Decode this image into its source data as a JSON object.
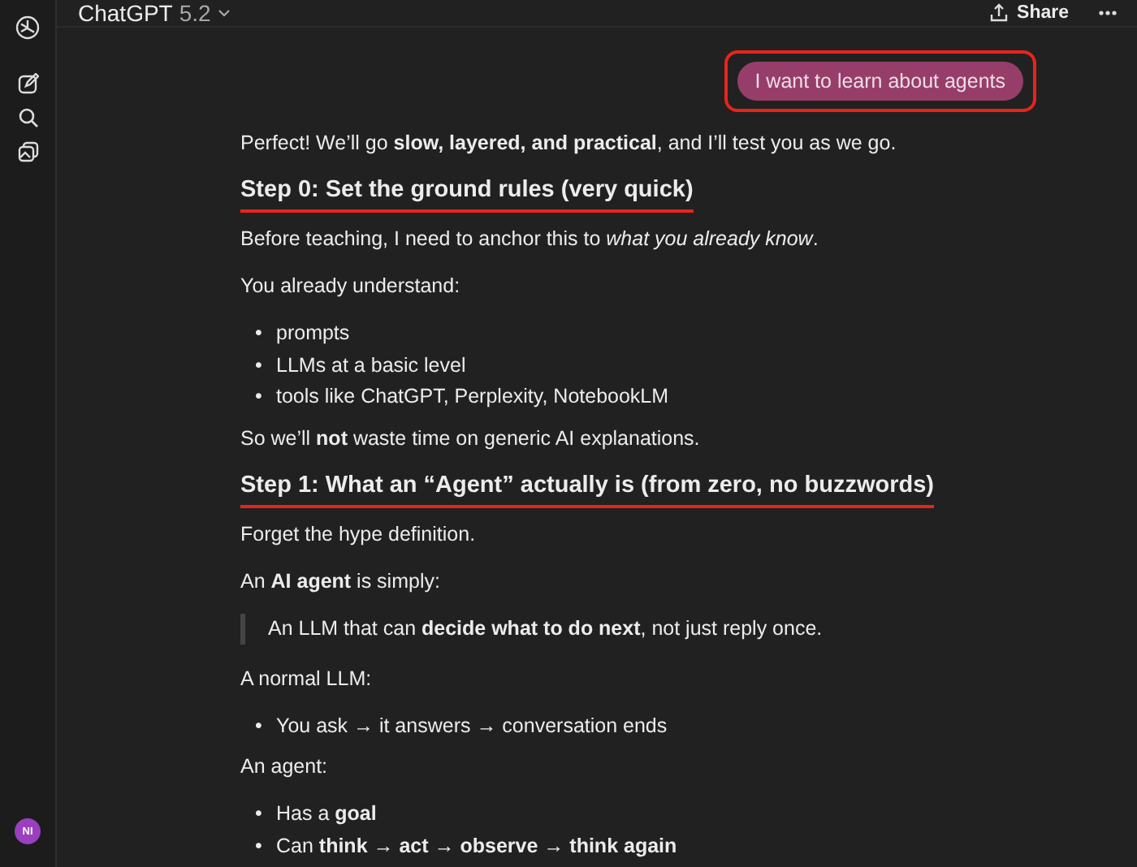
{
  "header": {
    "title": "ChatGPT",
    "version": "5.2",
    "share": "Share"
  },
  "sidebar": {
    "avatar": "NI"
  },
  "user_message": {
    "text": "I want to learn about agents",
    "highlighted": true
  },
  "blocks": [
    {
      "kind": "paragraph",
      "text": "Perfect! We’ll go **slow, layered, and practical**, and I’ll test you as we go."
    },
    {
      "kind": "heading",
      "text": "Step 0: Set the ground rules (very quick)",
      "highlighted": true
    },
    {
      "kind": "paragraph",
      "text": "Before teaching, I need to anchor this to *what you already know*."
    },
    {
      "kind": "paragraph",
      "text": "You already understand:"
    },
    {
      "kind": "list",
      "marker": "•",
      "items": [
        "prompts",
        "LLMs at a basic level",
        "tools like ChatGPT, Perplexity, NotebookLM"
      ]
    },
    {
      "kind": "paragraph",
      "text": "So we’ll **not** waste time on generic AI explanations."
    },
    {
      "kind": "heading",
      "text": "Step 1: What an “Agent” actually is (from zero, no buzzwords)",
      "highlighted": true
    },
    {
      "kind": "paragraph",
      "text": "Forget the hype definition."
    },
    {
      "kind": "paragraph",
      "text": "An **AI agent** is simply:"
    },
    {
      "kind": "quote",
      "text": "An LLM that can **decide what to do next**, not just reply once."
    },
    {
      "kind": "paragraph",
      "text": "A normal LLM:"
    },
    {
      "kind": "list",
      "marker": "•",
      "items": [
        "You ask → it answers → conversation ends"
      ]
    },
    {
      "kind": "paragraph",
      "text": "An agent:"
    },
    {
      "kind": "list",
      "marker": "•",
      "items": [
        "Has a **goal**",
        "Can **think** → **act** → **observe** → **think again**"
      ]
    }
  ]
}
